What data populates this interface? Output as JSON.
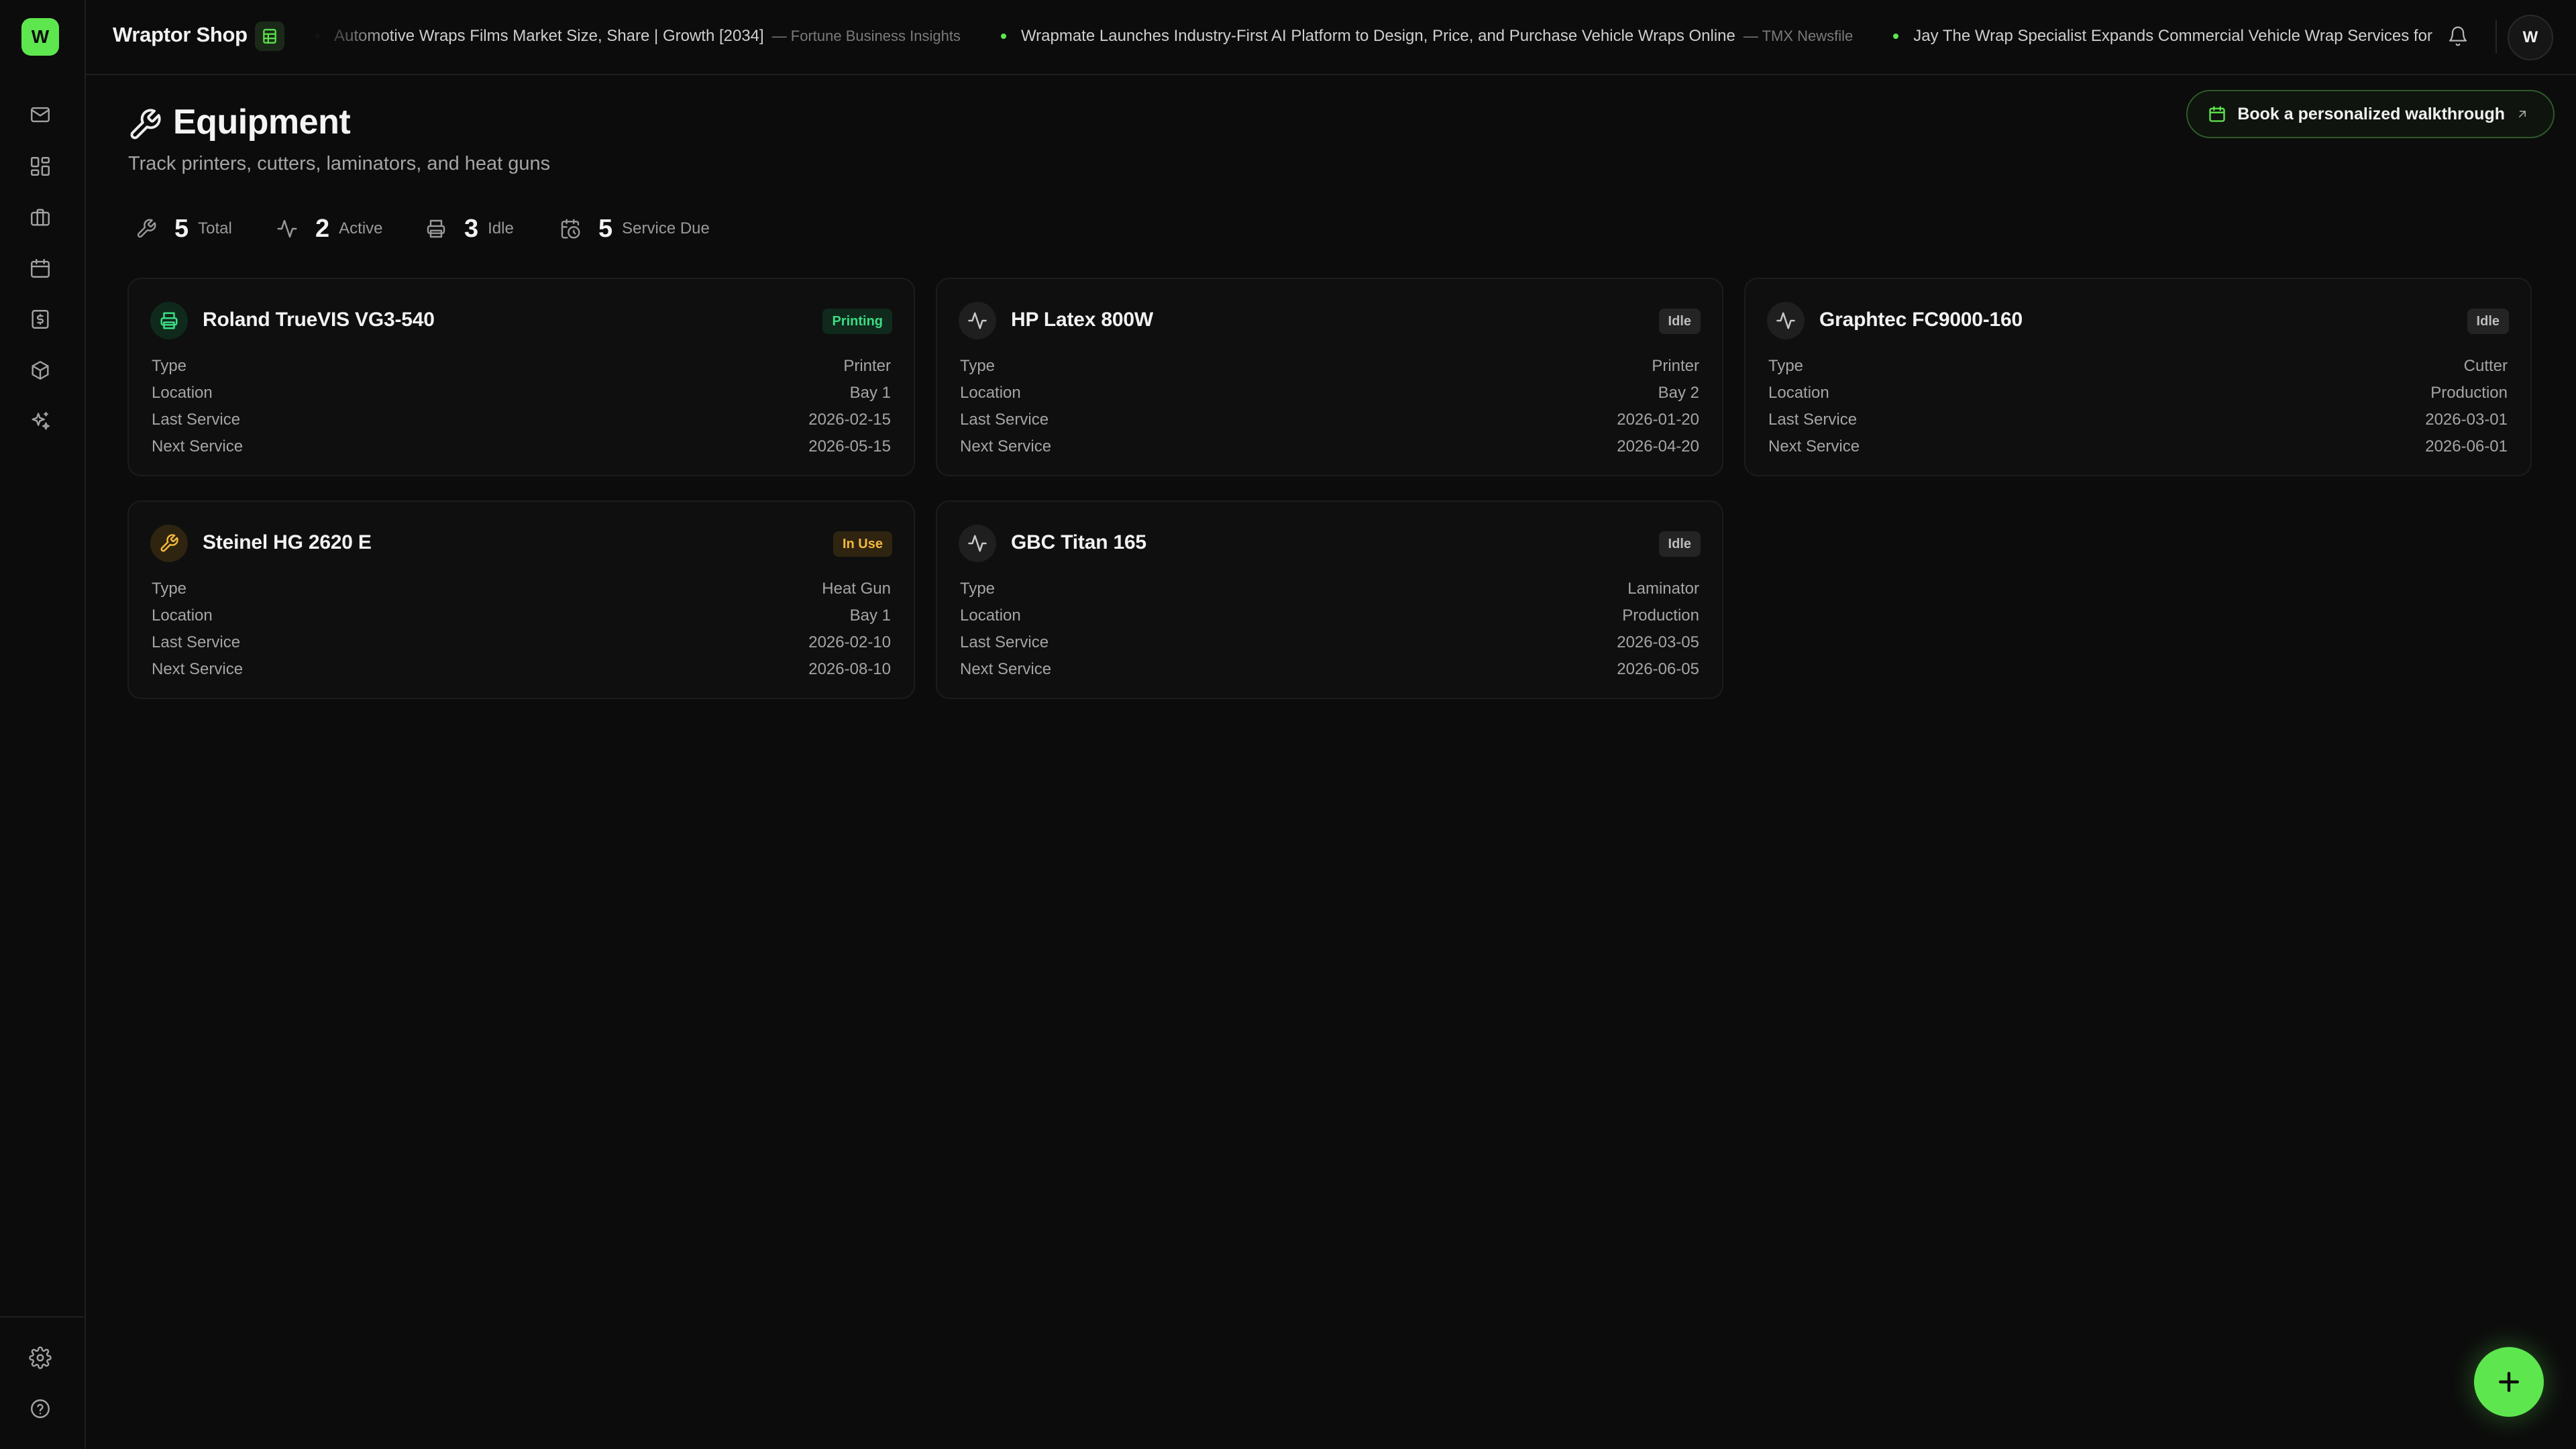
{
  "app": {
    "logo_letter": "W",
    "shop_name": "Wraptor Shop",
    "avatar_initial": "W"
  },
  "sidebar": {
    "items": [
      {
        "icon": "mail-icon"
      },
      {
        "icon": "dashboard-grid-icon"
      },
      {
        "icon": "briefcase-icon"
      },
      {
        "icon": "calendar-icon"
      },
      {
        "icon": "invoice-dollar-icon"
      },
      {
        "icon": "package-box-icon"
      },
      {
        "icon": "sparkles-icon"
      }
    ],
    "bottom_items": [
      {
        "icon": "gear-icon"
      },
      {
        "icon": "help-circle-icon"
      }
    ]
  },
  "ticker": {
    "items": [
      {
        "headline": "Automotive Wraps Films Market Size, Share | Growth [2034]",
        "source": "— Fortune Business Insights"
      },
      {
        "headline": "Wrapmate Launches Industry-First AI Platform to Design, Price, and Purchase Vehicle Wraps Online",
        "source": "— TMX Newsfile"
      },
      {
        "headline": "Jay The Wrap Specialist Expands Commercial Vehicle Wrap Services for",
        "source": ""
      }
    ]
  },
  "header": {
    "title": "Equipment",
    "subtitle": "Track printers, cutters, laminators, and heat guns",
    "walkthrough_label": "Book a personalized walkthrough"
  },
  "stats": {
    "total": {
      "value": "5",
      "label": "Total"
    },
    "active": {
      "value": "2",
      "label": "Active"
    },
    "idle": {
      "value": "3",
      "label": "Idle"
    },
    "service_due": {
      "value": "5",
      "label": "Service Due"
    }
  },
  "row_labels": {
    "type": "Type",
    "location": "Location",
    "last_service": "Last Service",
    "next_service": "Next Service"
  },
  "equipment": [
    {
      "name": "Roland TrueVIS VG3-540",
      "status": "Printing",
      "status_kind": "printing",
      "icon": "printer-icon",
      "type": "Printer",
      "location": "Bay 1",
      "last_service": "2026-02-15",
      "next_service": "2026-05-15"
    },
    {
      "name": "HP Latex 800W",
      "status": "Idle",
      "status_kind": "idle",
      "icon": "activity-pulse-icon",
      "type": "Printer",
      "location": "Bay 2",
      "last_service": "2026-01-20",
      "next_service": "2026-04-20"
    },
    {
      "name": "Graphtec FC9000-160",
      "status": "Idle",
      "status_kind": "idle",
      "icon": "activity-pulse-icon",
      "type": "Cutter",
      "location": "Production",
      "last_service": "2026-03-01",
      "next_service": "2026-06-01"
    },
    {
      "name": "Steinel HG 2620 E",
      "status": "In Use",
      "status_kind": "inuse",
      "icon": "wrench-icon",
      "type": "Heat Gun",
      "location": "Bay 1",
      "last_service": "2026-02-10",
      "next_service": "2026-08-10"
    },
    {
      "name": "GBC Titan 165",
      "status": "Idle",
      "status_kind": "idle",
      "icon": "activity-pulse-icon",
      "type": "Laminator",
      "location": "Production",
      "last_service": "2026-03-05",
      "next_service": "2026-06-05"
    }
  ],
  "colors": {
    "accent": "#5ee64f",
    "background": "#0c0c0c",
    "status_printing": "#3ddc84",
    "status_in_use": "#f5b83d",
    "status_idle": "#bdbdbd"
  }
}
